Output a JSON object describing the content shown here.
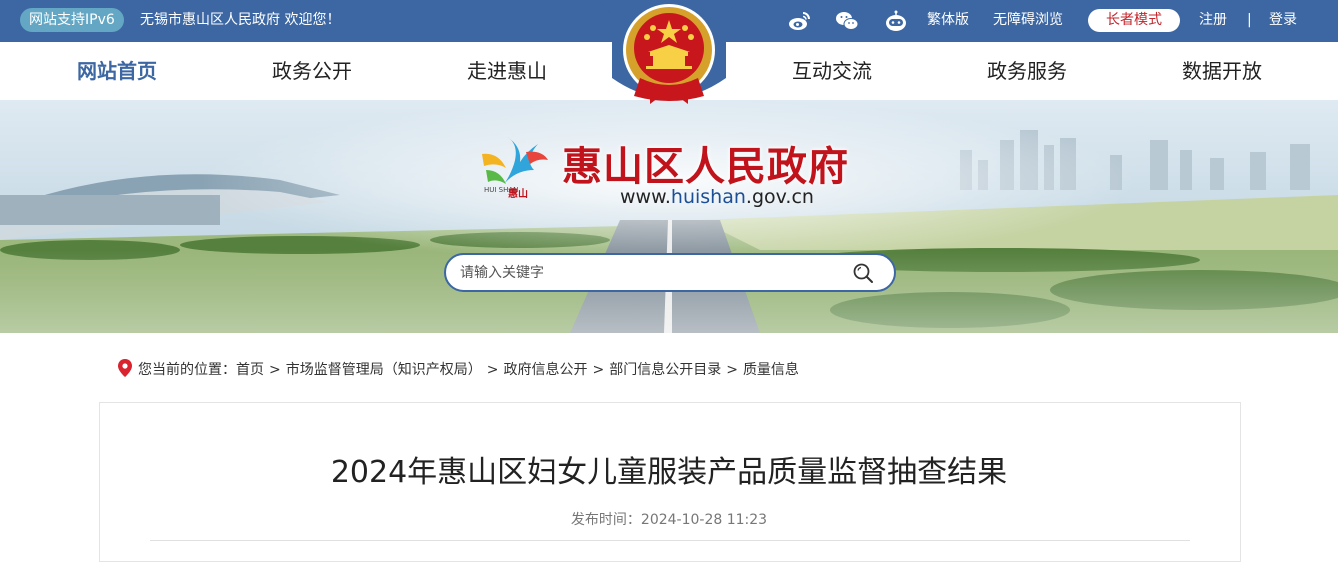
{
  "topbar": {
    "ipv6_badge": "网站支持IPv6",
    "welcome": "无锡市惠山区人民政府 欢迎您！",
    "icons": [
      "weibo-icon",
      "wechat-icon",
      "robot-icon"
    ],
    "traditional": "繁体版",
    "accessibility": "无障碍浏览",
    "elder_mode": "长者模式",
    "register": "注册",
    "separator": "|",
    "login": "登录"
  },
  "nav": {
    "items": [
      "网站首页",
      "政务公开",
      "走进惠山",
      "互动交流",
      "政务服务",
      "数据开放"
    ],
    "active": "网站首页"
  },
  "banner": {
    "site_name": "惠山区人民政府",
    "url_prefix": "www.",
    "url_highlight": "huishan",
    "url_suffix": ".gov.cn",
    "logo_sub": "HUI SHAN",
    "logo_cn": "惠山"
  },
  "search": {
    "placeholder": "请输入关键字"
  },
  "breadcrumb": {
    "prefix": "您当前的位置：",
    "items": [
      "首页",
      "市场监督管理局（知识产权局）",
      "政府信息公开",
      "部门信息公开目录",
      "质量信息"
    ],
    "sep": ">"
  },
  "article": {
    "title": "2024年惠山区妇女儿童服装产品质量监督抽查结果",
    "publish_label": "发布时间：",
    "publish_time": "2024-10-28 11:23"
  },
  "colors": {
    "primary_blue": "#3c67a3",
    "accent_red": "#c1131b",
    "ipv6_badge": "#63a7c4"
  }
}
